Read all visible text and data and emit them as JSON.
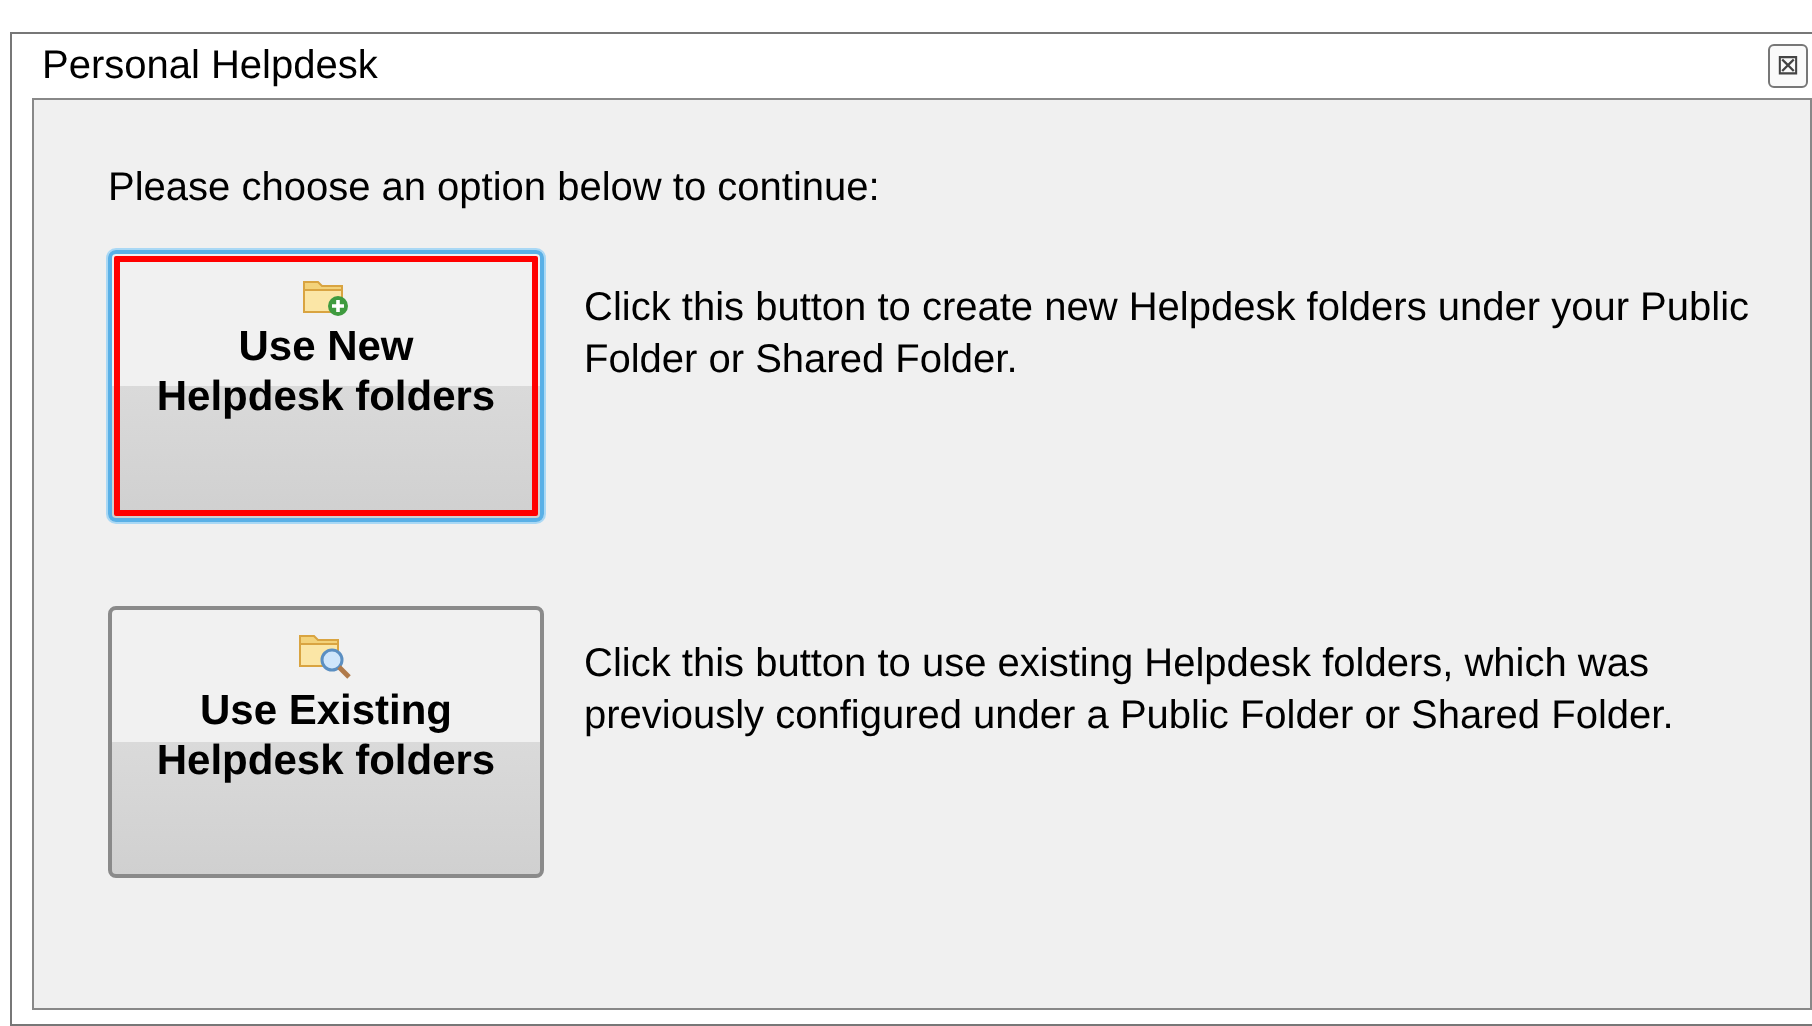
{
  "window": {
    "title": "Personal Helpdesk",
    "close": "⊠"
  },
  "prompt": "Please choose an option below to continue:",
  "options": [
    {
      "kind": "new",
      "label_lines": [
        "Use New",
        "Helpdesk folders"
      ],
      "description": "Click this button to create new Helpdesk folders under your Public Folder or Shared Folder.",
      "focused": true,
      "highlighted": true
    },
    {
      "kind": "existing",
      "label_lines": [
        "Use Existing",
        "Helpdesk folders"
      ],
      "description": "Click this button to use existing Helpdesk folders, which was previously configured under a Public Folder or Shared Folder.",
      "focused": false,
      "highlighted": false
    }
  ]
}
